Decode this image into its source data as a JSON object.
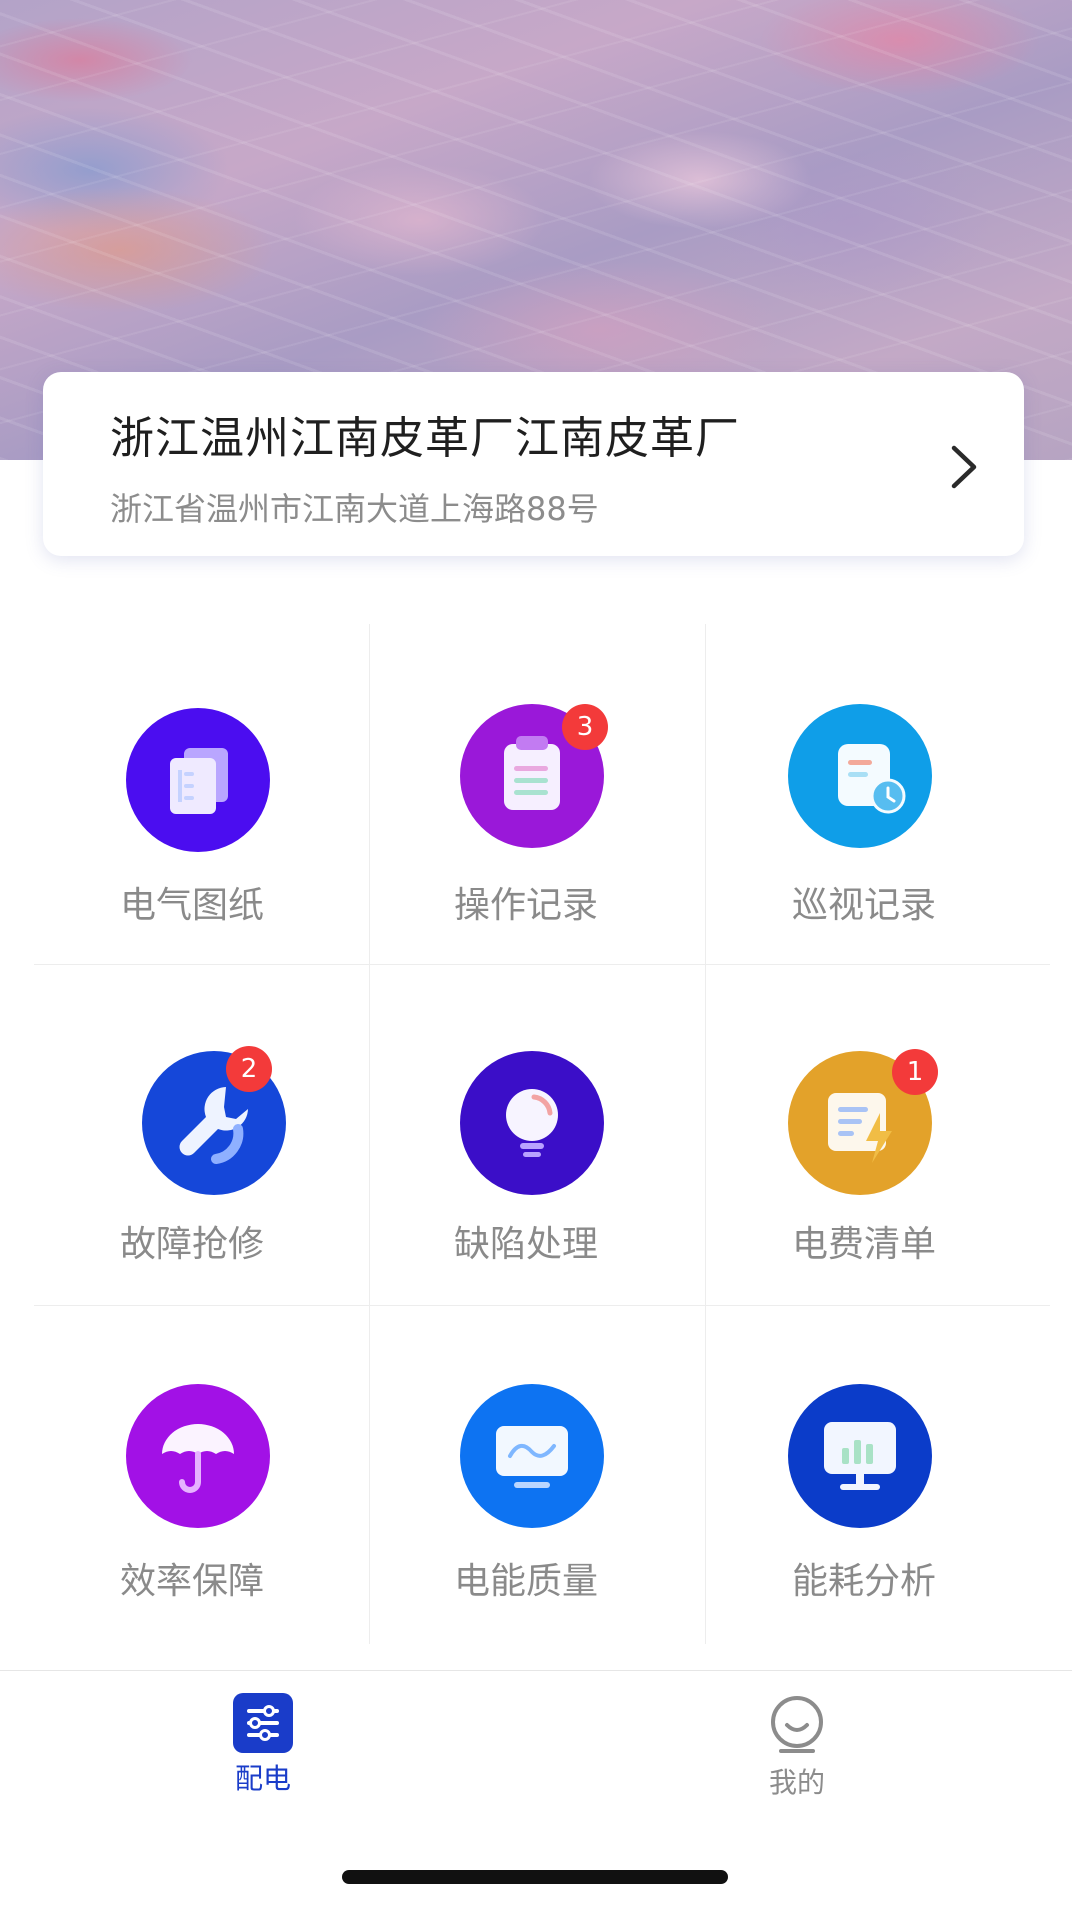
{
  "factory": {
    "name": "浙江温州江南皮革厂江南皮革厂",
    "address": "浙江省温州市江南大道上海路88号"
  },
  "functions": [
    {
      "label": "电气图纸",
      "badge": null,
      "color": "#4b0df0"
    },
    {
      "label": "操作记录",
      "badge": "3",
      "color": "#9a18d9"
    },
    {
      "label": "巡视记录",
      "badge": null,
      "color": "#0f9ee8"
    },
    {
      "label": "故障抢修",
      "badge": "2",
      "color": "#1547d9"
    },
    {
      "label": "缺陷处理",
      "badge": null,
      "color": "#3b0ec8"
    },
    {
      "label": "电费清单",
      "badge": "1",
      "color": "#e3a22a"
    },
    {
      "label": "效率保障",
      "badge": null,
      "color": "#a211e6"
    },
    {
      "label": "电能质量",
      "badge": null,
      "color": "#0d73f2"
    },
    {
      "label": "能耗分析",
      "badge": null,
      "color": "#0b3cc9"
    }
  ],
  "tabs": [
    {
      "label": "配电",
      "active": true
    },
    {
      "label": "我的",
      "active": false
    }
  ],
  "colors": {
    "accent": "#1a3cc9",
    "badge": "#f33a3a",
    "label_gray": "#8a8a8a"
  }
}
